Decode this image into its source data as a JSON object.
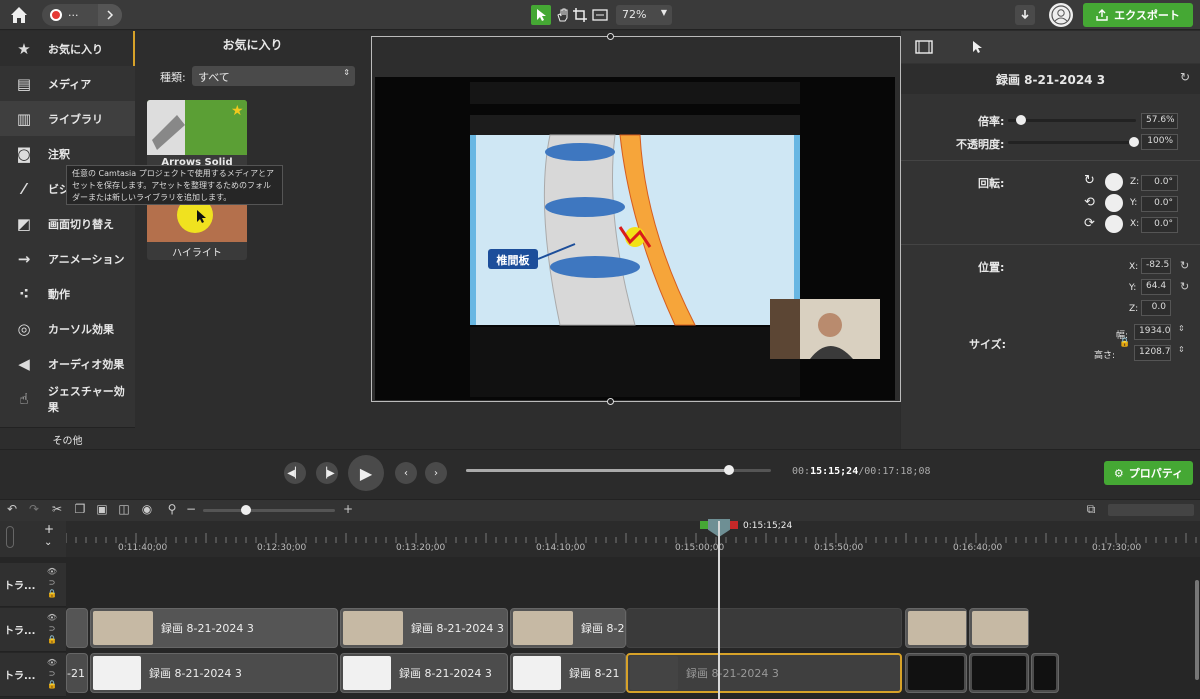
{
  "topbar": {
    "zoom": "72%",
    "export_label": "エクスポート",
    "record_menu": "···"
  },
  "sidebar": {
    "items": [
      {
        "label": "お気に入り"
      },
      {
        "label": "メディア"
      },
      {
        "label": "ライブラリ"
      },
      {
        "label": "注釈"
      },
      {
        "label": "ビジ"
      },
      {
        "label": "画面切り替え"
      },
      {
        "label": "アニメーション"
      },
      {
        "label": "動作"
      },
      {
        "label": "カーソル効果"
      },
      {
        "label": "オーディオ効果"
      },
      {
        "label": "ジェスチャー効果"
      }
    ],
    "other_label": "その他"
  },
  "favorites": {
    "title": "お気に入り",
    "category_label": "種類:",
    "category_value": "すべて",
    "cards": [
      {
        "label": "Arrows Solid"
      },
      {
        "label": "ハイライト"
      }
    ],
    "tooltip": "任意の Camtasia プロジェクトで使用するメディアとアセットを保存します。アセットを整理するためのフォルダーまたは新しいライブラリを追加します。"
  },
  "preview": {
    "callout": "椎間板"
  },
  "properties": {
    "clip_title": "録画 8-21-2024 3",
    "scale_label": "倍率:",
    "scale_value": "57.6%",
    "scale_level": 0.576,
    "opacity_label": "不透明度:",
    "opacity_value": "100%",
    "opacity_level": 1.0,
    "rotation_label": "回転:",
    "rot_z_label": "Z:",
    "rot_z": "0.0°",
    "rot_y_label": "Y:",
    "rot_y": "0.0°",
    "rot_x_label": "X:",
    "rot_x": "0.0°",
    "position_label": "位置:",
    "pos_x_label": "X:",
    "pos_x": "-82.5",
    "pos_y_label": "Y:",
    "pos_y": "64.4",
    "pos_z_label": "Z:",
    "pos_z": "0.0",
    "size_label": "サイズ:",
    "width_label": "幅:",
    "width": "1934.0",
    "height_label": "高さ:",
    "height": "1208.7"
  },
  "transport": {
    "time_prefix": "00:",
    "time_current": "15:15;24",
    "time_total": "/00:17:18;08",
    "progress": 0.862,
    "properties_label": "プロパティ"
  },
  "timeline": {
    "playhead_label": "0:15:15;24",
    "ticks": [
      "0:11:40;00",
      "0:12:30;00",
      "0:13:20;00",
      "0:14:10;00",
      "0:15:00;00",
      "0:15:50;00",
      "0:16:40;00",
      "0:17:30;00"
    ],
    "tracks": [
      {
        "label": "トラ..."
      },
      {
        "label": "トラ..."
      },
      {
        "label": "トラ..."
      }
    ],
    "clip_label": "録画 8-21-2024 3",
    "clip_label_cut": "録画 8-21",
    "clip_label_left": "-21"
  },
  "colors": {
    "accent_green": "#45a834",
    "selection_yellow": "#d7a229"
  }
}
